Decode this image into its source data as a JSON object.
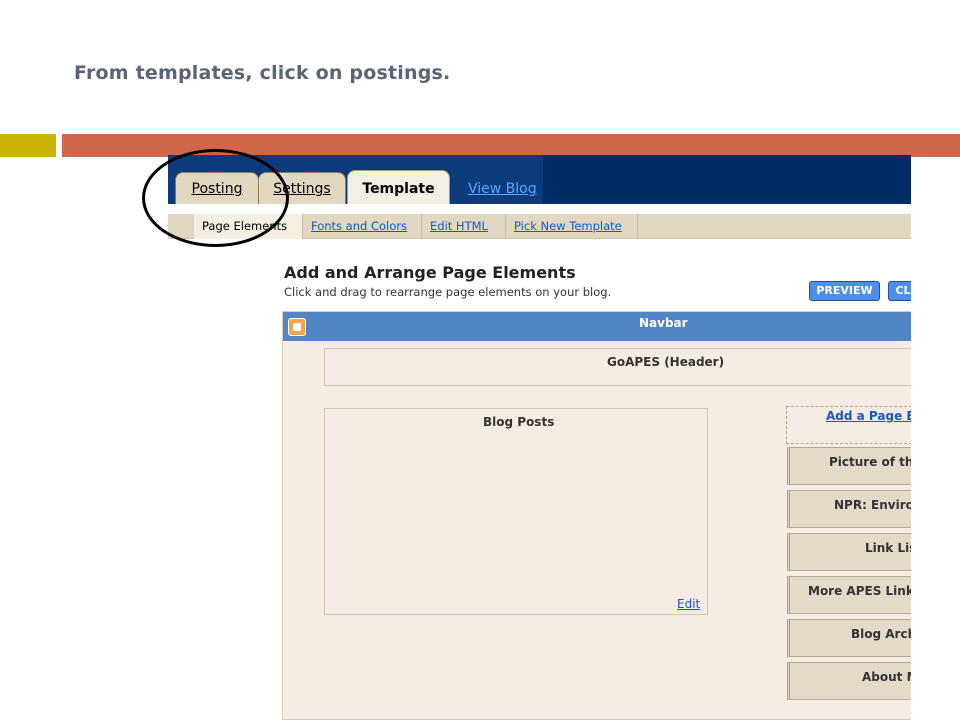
{
  "slide": {
    "title": "From templates, click on postings."
  },
  "tabs": {
    "posting": "Posting",
    "settings": "Settings",
    "template": "Template",
    "view_blog": "View Blog"
  },
  "subtabs": {
    "page_elements": "Page Elements",
    "fonts_colors": "Fonts and Colors",
    "edit_html": "Edit HTML",
    "pick_template": "Pick New Template"
  },
  "main": {
    "heading": "Add and Arrange Page Elements",
    "subheading": "Click and drag to rearrange page elements on your blog.",
    "preview_label": "PREVIEW",
    "clear_label": "CL"
  },
  "layout": {
    "navbar": "Navbar",
    "header": "GoAPES (Header)",
    "blog_posts": "Blog Posts",
    "edit_link": "Edit",
    "add_element": "Add a Page E",
    "gadgets": [
      "Picture of the",
      "NPR: Enviror",
      "Link Lis",
      "More APES Links",
      "Blog Arch",
      "About M"
    ]
  },
  "colors": {
    "accent_bar": "#d0654a",
    "side_bar": "#c9b200",
    "tab_bar": "#002c66",
    "navbar": "#5285c5"
  }
}
